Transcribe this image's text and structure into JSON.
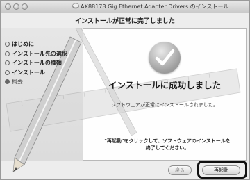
{
  "window": {
    "title": "AX88178 Gig Ethernet Adapter Drivers のインストール",
    "subtitle": "インストールが正常に完了しました"
  },
  "sidebar": {
    "steps": [
      {
        "label": "はじめに"
      },
      {
        "label": "インストール先の選択"
      },
      {
        "label": "インストールの種類"
      },
      {
        "label": "インストール"
      },
      {
        "label": "概要"
      }
    ]
  },
  "main": {
    "heading": "インストールに成功しました",
    "message": "ソフトウェアが正常にインストールされました。",
    "instruction_line1": "\"再起動\"をクリックして、ソフトウェアのインストールを",
    "instruction_line2": "終了してください。"
  },
  "buttons": {
    "back_label": "戻る",
    "restart_label": "再起動"
  },
  "colors": {
    "highlight": "#111111",
    "window_bg": "#ededed"
  }
}
